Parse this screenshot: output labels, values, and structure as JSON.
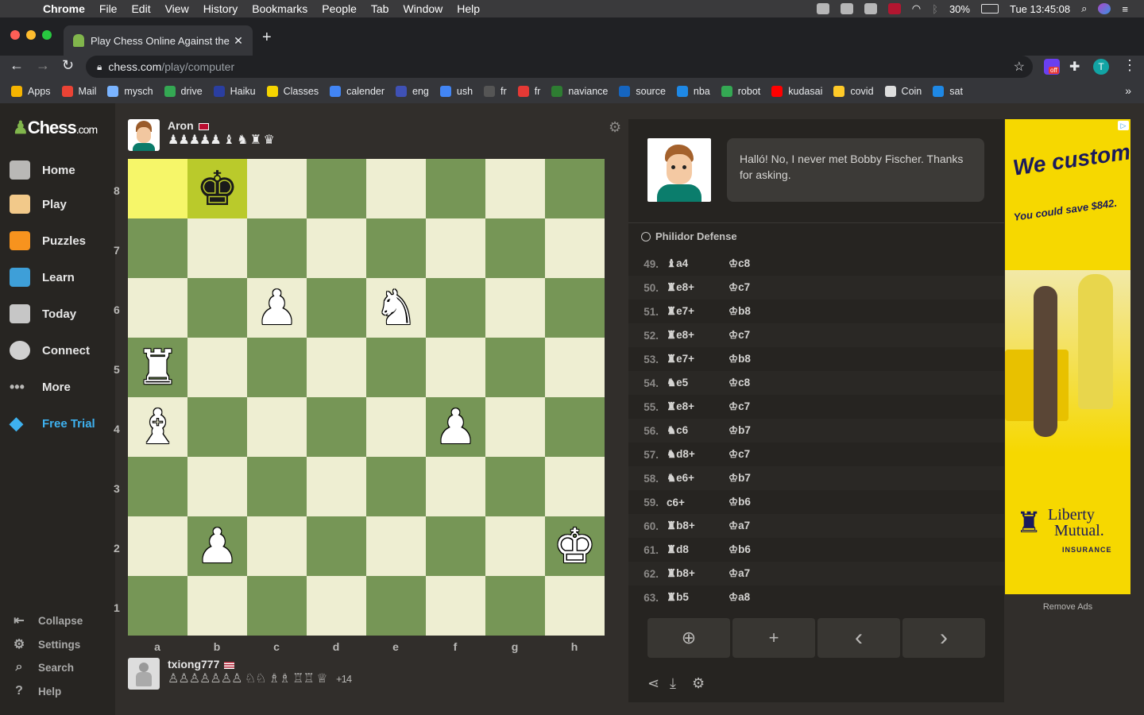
{
  "menubar": {
    "app": "Chrome",
    "items": [
      "File",
      "Edit",
      "View",
      "History",
      "Bookmarks",
      "People",
      "Tab",
      "Window",
      "Help"
    ],
    "battery": "30%",
    "clock": "Tue 13:45:08"
  },
  "tab": {
    "title": "Play Chess Online Against the"
  },
  "url": {
    "host": "chess.com",
    "path": "/play/computer"
  },
  "extension_badge": "off",
  "profile_initial": "T",
  "bookmarks": [
    {
      "label": "Apps",
      "color": "#f5b400"
    },
    {
      "label": "Mail",
      "color": "#ea4335"
    },
    {
      "label": "mysch",
      "color": "#7ab4ff"
    },
    {
      "label": "drive",
      "color": "#34a853"
    },
    {
      "label": "Haiku",
      "color": "#2a3ea0"
    },
    {
      "label": "Classes",
      "color": "#f5d400"
    },
    {
      "label": "calender",
      "color": "#4285f4"
    },
    {
      "label": "eng",
      "color": "#3f51b5"
    },
    {
      "label": "ush",
      "color": "#4285f4"
    },
    {
      "label": "fr",
      "color": "#555555"
    },
    {
      "label": "fr",
      "color": "#e53935"
    },
    {
      "label": "naviance",
      "color": "#2e7d32"
    },
    {
      "label": "source",
      "color": "#1565c0"
    },
    {
      "label": "nba",
      "color": "#1e88e5"
    },
    {
      "label": "robot",
      "color": "#34a853"
    },
    {
      "label": "kudasai",
      "color": "#ff0000"
    },
    {
      "label": "covid",
      "color": "#ffca28"
    },
    {
      "label": "Coin",
      "color": "#dddddd"
    },
    {
      "label": "sat",
      "color": "#1e88e5"
    }
  ],
  "sidebar": {
    "logo_main": "Chess",
    "logo_suffix": ".com",
    "items": [
      {
        "label": "Home",
        "color": "#b9b8b6"
      },
      {
        "label": "Play",
        "color": "#f2c98a"
      },
      {
        "label": "Puzzles",
        "color": "#f7931e"
      },
      {
        "label": "Learn",
        "color": "#3e9fd8"
      },
      {
        "label": "Today",
        "color": "#c6c6c6"
      },
      {
        "label": "Connect",
        "color": "#d0d0d0"
      },
      {
        "label": "More",
        "color": "#b9b8b6"
      }
    ],
    "trial": "Free Trial",
    "bottom": [
      "Collapse",
      "Settings",
      "Search",
      "Help"
    ]
  },
  "top_player": {
    "name": "Aron",
    "captured": "♟♟♟♟♟ ♝ ♞ ♜ ♛"
  },
  "bottom_player": {
    "name": "txiong777",
    "captured": "♙♙♙♙♙♙♙ ♘♘ ♗♗ ♖♖ ♕",
    "score": "+14"
  },
  "board": {
    "ranks": [
      "8",
      "7",
      "6",
      "5",
      "4",
      "3",
      "2",
      "1"
    ],
    "files": [
      "a",
      "b",
      "c",
      "d",
      "e",
      "f",
      "g",
      "h"
    ],
    "highlight": [
      "a8",
      "b8"
    ],
    "pieces": [
      {
        "square": "b8",
        "glyph": "♚",
        "color": "black"
      },
      {
        "square": "c6",
        "glyph": "♟",
        "color": "white"
      },
      {
        "square": "e6",
        "glyph": "♞",
        "color": "white"
      },
      {
        "square": "a5",
        "glyph": "♜",
        "color": "white"
      },
      {
        "square": "a4",
        "glyph": "♝",
        "color": "white"
      },
      {
        "square": "f4",
        "glyph": "♟",
        "color": "white"
      },
      {
        "square": "b2",
        "glyph": "♟",
        "color": "white"
      },
      {
        "square": "h2",
        "glyph": "♚",
        "color": "white"
      }
    ],
    "colors": {
      "light": "#eeeed2",
      "dark": "#769656"
    }
  },
  "coach": {
    "message": "Halló! No, I never met Bobby Fischer. Thanks for asking."
  },
  "opening": "Philidor Defense",
  "moves": [
    {
      "num": "49.",
      "white": "♝a4",
      "black": "♔c8"
    },
    {
      "num": "50.",
      "white": "♜e8+",
      "black": "♔c7"
    },
    {
      "num": "51.",
      "white": "♜e7+",
      "black": "♔b8"
    },
    {
      "num": "52.",
      "white": "♜e8+",
      "black": "♔c7"
    },
    {
      "num": "53.",
      "white": "♜e7+",
      "black": "♔b8"
    },
    {
      "num": "54.",
      "white": "♞e5",
      "black": "♔c8"
    },
    {
      "num": "55.",
      "white": "♜e8+",
      "black": "♔c7"
    },
    {
      "num": "56.",
      "white": "♞c6",
      "black": "♔b7"
    },
    {
      "num": "57.",
      "white": "♞d8+",
      "black": "♔c7"
    },
    {
      "num": "58.",
      "white": "♞e6+",
      "black": "♔b7"
    },
    {
      "num": "59.",
      "white": "c6+",
      "black": "♔b6"
    },
    {
      "num": "60.",
      "white": "♜b8+",
      "black": "♔a7"
    },
    {
      "num": "61.",
      "white": "♜d8",
      "black": "♔b6"
    },
    {
      "num": "62.",
      "white": "♜b8+",
      "black": "♔a7"
    },
    {
      "num": "63.",
      "white": "♜b5",
      "black": "♔a8"
    }
  ],
  "controls": [
    "⊕",
    "+",
    "‹",
    "›"
  ],
  "ad": {
    "headline": "We customize.",
    "subline": "You could save $842.",
    "brand_1": "Liberty",
    "brand_2": "Mutual.",
    "brand_3": "INSURANCE",
    "choice": "▷"
  },
  "remove_ads": "Remove Ads"
}
